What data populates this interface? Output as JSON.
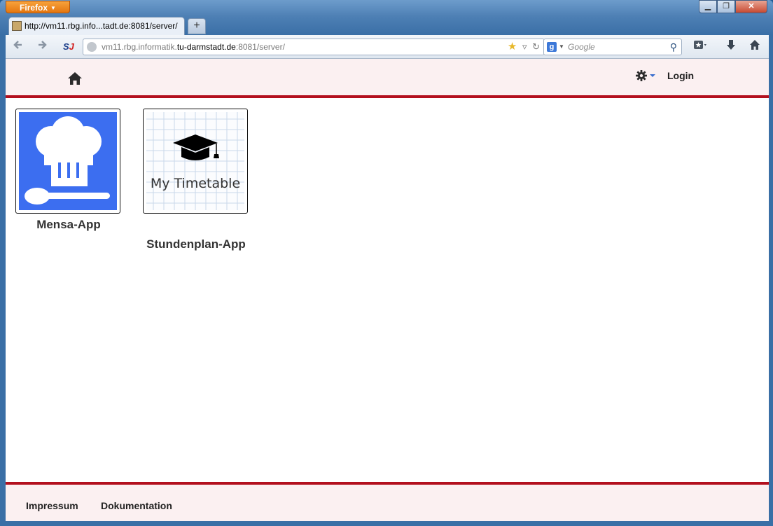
{
  "browser": {
    "app_button": "Firefox",
    "tab_title": "http://vm11.rbg.info...tadt.de:8081/server/",
    "newtab_label": "+",
    "url_prefix": "vm11.rbg.informatik.",
    "url_host": "tu-darmstadt.de",
    "url_suffix": ":8081/server/",
    "search_placeholder": "Google",
    "search_engine_glyph": "g",
    "addon_text_1": "S",
    "addon_text_2": "J"
  },
  "window_controls": {
    "minimize": "▁",
    "maximize": "❐",
    "close": "✕"
  },
  "header": {
    "login_label": "Login"
  },
  "apps": [
    {
      "name": "Mensa-App",
      "icon": "chef-hat-spoon-icon",
      "bg_color": "#3c6ef0"
    },
    {
      "name": "Stundenplan-App",
      "icon": "my-timetable-icon",
      "icon_text": "My Timetable"
    }
  ],
  "footer": {
    "links": [
      {
        "label": "Impressum"
      },
      {
        "label": "Dokumentation"
      }
    ]
  },
  "colors": {
    "accent": "#b3101e",
    "header_bg": "#fbf0f1",
    "gear_caret": "#3b6fcf"
  }
}
